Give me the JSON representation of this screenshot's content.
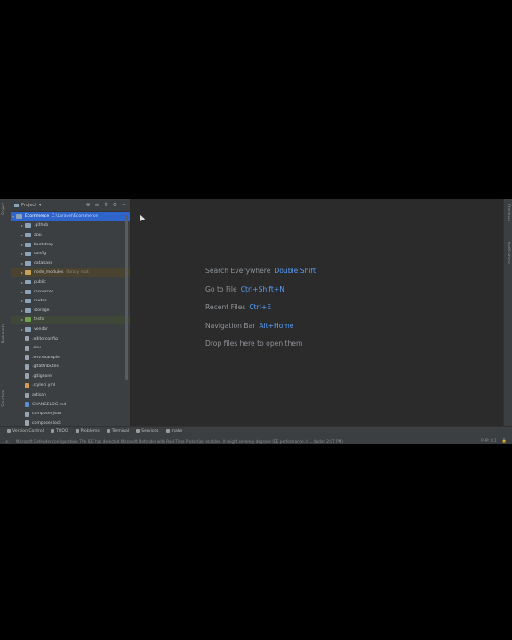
{
  "project_panel": {
    "title": "Project",
    "root": {
      "name": "Ecommerce",
      "path": "C:\\Laravel\\Ecommerce"
    },
    "items": [
      {
        "name": ".github",
        "kind": "folder"
      },
      {
        "name": "app",
        "kind": "folder"
      },
      {
        "name": "bootstrap",
        "kind": "folder"
      },
      {
        "name": "config",
        "kind": "folder"
      },
      {
        "name": "database",
        "kind": "folder"
      },
      {
        "name": "node_modules",
        "kind": "folder-excluded",
        "note": "library root"
      },
      {
        "name": "public",
        "kind": "folder"
      },
      {
        "name": "resources",
        "kind": "folder"
      },
      {
        "name": "routes",
        "kind": "folder"
      },
      {
        "name": "storage",
        "kind": "folder"
      },
      {
        "name": "tests",
        "kind": "folder-test"
      },
      {
        "name": "vendor",
        "kind": "folder"
      },
      {
        "name": ".editorconfig",
        "kind": "file"
      },
      {
        "name": ".env",
        "kind": "file"
      },
      {
        "name": ".env.example",
        "kind": "file"
      },
      {
        "name": ".gitattributes",
        "kind": "file"
      },
      {
        "name": ".gitignore",
        "kind": "file"
      },
      {
        "name": ".styleci.yml",
        "kind": "file-orange"
      },
      {
        "name": "artisan",
        "kind": "file"
      },
      {
        "name": "CHANGELOG.md",
        "kind": "file-blue"
      },
      {
        "name": "composer.json",
        "kind": "file"
      },
      {
        "name": "composer.lock",
        "kind": "file"
      }
    ]
  },
  "left_strip": [
    "Project",
    "Bookmarks",
    "Structure"
  ],
  "right_strip": [
    "Database",
    "Notifications"
  ],
  "editor_hints": [
    {
      "label": "Search Everywhere",
      "shortcut": "Double Shift"
    },
    {
      "label": "Go to File",
      "shortcut": "Ctrl+Shift+N"
    },
    {
      "label": "Recent Files",
      "shortcut": "Ctrl+E"
    },
    {
      "label": "Navigation Bar",
      "shortcut": "Alt+Home"
    },
    {
      "label": "Drop files here to open them",
      "shortcut": ""
    }
  ],
  "tool_windows": [
    "Version Control",
    "TODO",
    "Problems",
    "Terminal",
    "Services",
    "make"
  ],
  "status": {
    "message": "Microsoft Defender configuration: The IDE has detected Microsoft Defender with Real-Time Protection enabled. It might severely degrade IDE performance. It... (today 2:07 PM)",
    "right": [
      "PHP: 8.1"
    ]
  }
}
